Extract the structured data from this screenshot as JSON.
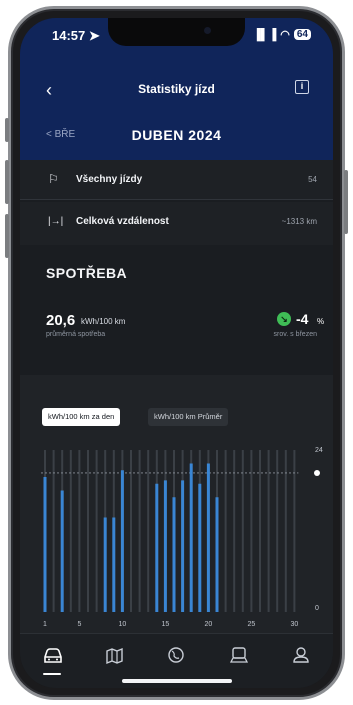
{
  "status_bar": {
    "time": "14:57",
    "signal": "▐▌▐",
    "wifi": "◠",
    "battery": "64"
  },
  "header": {
    "back_icon": "chevron-left-icon",
    "title": "Statistiky jízd",
    "info_icon": "info-icon"
  },
  "month_nav": {
    "prev_label": "< BŘE",
    "current": "DUBEN 2024"
  },
  "rows": [
    {
      "icon": "checkered-flag-icon",
      "label": "Všechny jízdy",
      "value": "54"
    },
    {
      "icon": "distance-icon",
      "label": "Celková vzdálenost",
      "value": "~1313 km"
    }
  ],
  "consumption": {
    "title": "SPOTŘEBA",
    "value": "20,6",
    "unit": "kWh/100 km",
    "sub": "průměrná spotřeba",
    "change_value": "-4",
    "change_unit": "%",
    "change_sub": "srov. s březen",
    "change_color": "#3fbd56"
  },
  "chart_toggles": {
    "active": "kWh/100 km za den",
    "inactive": "kWh/100 km Průměr"
  },
  "chart_data": {
    "type": "bar",
    "categories": [
      1,
      2,
      3,
      4,
      5,
      6,
      7,
      8,
      9,
      10,
      11,
      12,
      13,
      14,
      15,
      16,
      17,
      18,
      19,
      20,
      21,
      22,
      23,
      24,
      25,
      26,
      27,
      28,
      29,
      30
    ],
    "values": [
      20,
      0,
      18,
      0,
      0,
      0,
      0,
      14,
      14,
      21,
      0,
      0,
      0,
      19,
      19.5,
      17,
      19.5,
      22,
      19,
      22,
      17,
      0,
      0,
      0,
      0,
      0,
      0,
      0,
      0,
      0
    ],
    "average": 20.6,
    "x_tick_labels": [
      "1",
      "5",
      "10",
      "15",
      "20",
      "25",
      "30"
    ],
    "x_ticks": [
      1,
      5,
      10,
      15,
      20,
      25,
      30
    ],
    "y_tick_labels": [
      "24",
      "0"
    ],
    "ylim": [
      0,
      24
    ],
    "bar_color": "#3a86d4",
    "empty_bar_color": "#3b4046"
  },
  "tabbar": {
    "tabs": [
      {
        "name": "car-icon",
        "active": true
      },
      {
        "name": "map-icon",
        "active": false
      },
      {
        "name": "globe-icon",
        "active": false
      },
      {
        "name": "service-icon",
        "active": false
      },
      {
        "name": "profile-icon",
        "active": false
      }
    ]
  }
}
